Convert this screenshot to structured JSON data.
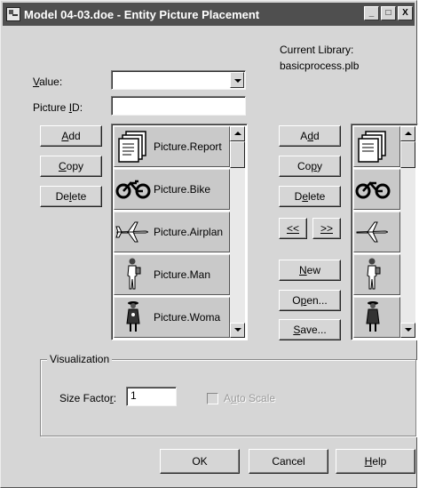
{
  "window": {
    "title": "Model 04-03.doe - Entity Picture Placement",
    "minimize": "_",
    "maximize": "□",
    "close": "X"
  },
  "library": {
    "heading": "Current Library:",
    "name": "basicprocess.plb"
  },
  "form": {
    "value_label_u": "V",
    "value_label_rest": "alue:",
    "value_value": "",
    "picture_id_label_pre": "Picture ",
    "picture_id_label_u": "I",
    "picture_id_label_post": "D:",
    "picture_id_value": ""
  },
  "left_buttons": {
    "add": {
      "u": "A",
      "rest": "dd"
    },
    "copy": {
      "u": "C",
      "rest": "opy"
    },
    "delete": {
      "pre": "De",
      "u": "l",
      "rest": "ete"
    }
  },
  "pictures": [
    {
      "label": "Picture.Report",
      "icon": "report-icon"
    },
    {
      "label": "Picture.Bike",
      "icon": "bike-icon"
    },
    {
      "label": "Picture.Airplan",
      "icon": "airplane-icon"
    },
    {
      "label": "Picture.Man",
      "icon": "man-icon"
    },
    {
      "label": "Picture.Woma",
      "icon": "woman-icon"
    }
  ],
  "right_buttons": {
    "add": {
      "pre": "A",
      "u": "d",
      "rest": "d"
    },
    "copy": {
      "pre": "Co",
      "u": "p",
      "rest": "y"
    },
    "delete": {
      "pre": "D",
      "u": "e",
      "rest": "lete"
    },
    "move_left": "<<",
    "move_right": ">>",
    "new": {
      "u": "N",
      "rest": "ew"
    },
    "open": {
      "pre": "O",
      "u": "p",
      "rest": "en..."
    },
    "save": {
      "u": "S",
      "rest": "ave..."
    }
  },
  "visualization": {
    "title": "Visualization",
    "size_factor_pre": "Size Facto",
    "size_factor_u": "r",
    "size_factor_post": ":",
    "size_factor_value": "1",
    "auto_scale_pre": "A",
    "auto_scale_u": "u",
    "auto_scale_rest": "to Scale"
  },
  "footer": {
    "ok": "OK",
    "cancel": "Cancel",
    "help_u": "H",
    "help_rest": "elp"
  }
}
